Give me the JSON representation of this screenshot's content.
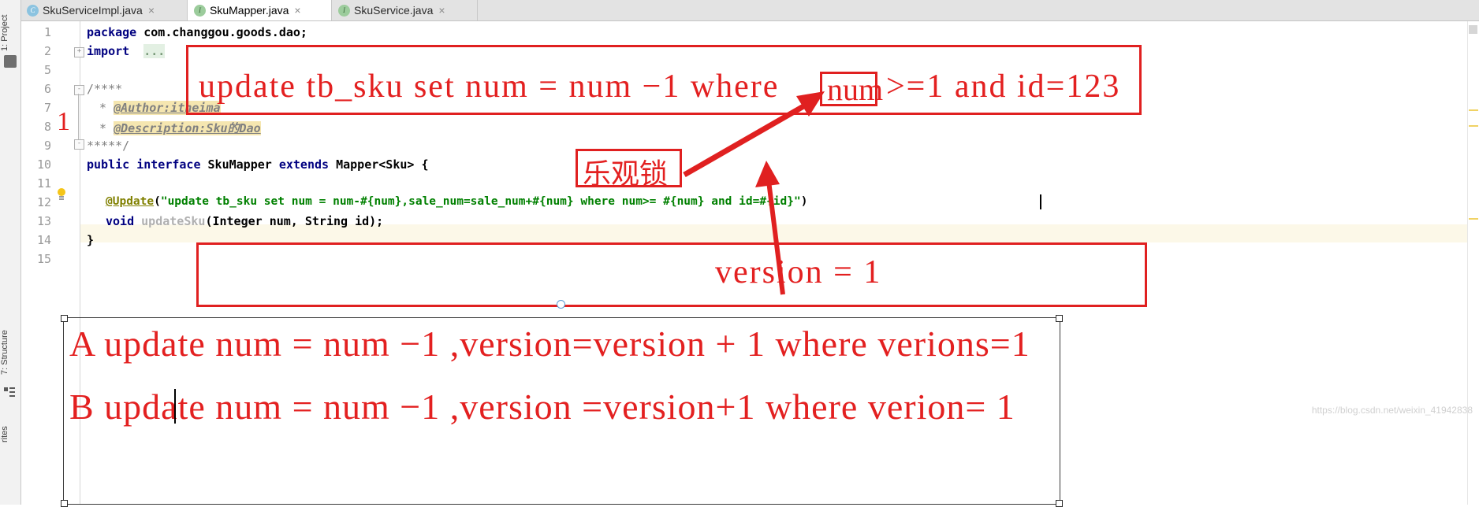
{
  "window": {
    "left_strip": {
      "project_label": "1: Project",
      "structure_label": "7: Structure",
      "favorites_label": "rites"
    }
  },
  "tabs": [
    {
      "label": "SkuServiceImpl.java",
      "icon": "class-icon",
      "icon_letter": "C",
      "active": false,
      "close": "×"
    },
    {
      "label": "SkuMapper.java",
      "icon": "interface-icon",
      "icon_letter": "I",
      "active": true,
      "close": "×"
    },
    {
      "label": "SkuService.java",
      "icon": "interface-icon",
      "icon_letter": "I",
      "active": false,
      "close": "×"
    }
  ],
  "editor": {
    "line_numbers": [
      "1",
      "2",
      "5",
      "6",
      "7",
      "8",
      "9",
      "10",
      "11",
      "12",
      "13",
      "14",
      "15"
    ],
    "lines": {
      "package_kw": "package",
      "package_name": " com.changgou.goods.dao;",
      "import_kw": "import",
      "import_dots": "...",
      "comment_open": "/****",
      "comment_author_star": "* ",
      "comment_author": "@Author:itheima",
      "comment_desc_star": "* ",
      "comment_desc": "@Description:Sku的Dao",
      "comment_close": "*****/",
      "iface_public": "public",
      "iface_interface": " interface ",
      "iface_name": "SkuMapper",
      "iface_extends": " extends ",
      "iface_super": "Mapper<Sku> {",
      "update_annotation": "@Update",
      "update_paren_open": "(",
      "update_string": "\"update tb_sku set num = num-#{num},sale_num=sale_num+#{num} where num>= #{num} and id=#{id}\"",
      "update_paren_close": ")",
      "method_void": "void",
      "method_name": " updateSku",
      "method_params": "(Integer num, String id);",
      "brace_close": "}"
    },
    "fold_expand": "+",
    "fold_collapse": "-"
  },
  "annotations": {
    "marker_number": "1",
    "top_sql_prefix": "update tb_sku set num = num −1 where",
    "top_sql_boxed": "num",
    "top_sql_suffix": ">=1 and id=123",
    "optimistic_lock": "乐观锁",
    "version_note": "version = 1",
    "option_a": "A update num = num −1 ,version=version + 1 where verions=1",
    "option_b": "B update num = num −1 ,version =version+1 where verion= 1",
    "watermark": "https://blog.csdn.net/weixin_41942838",
    "accent_red": "#e32020"
  }
}
